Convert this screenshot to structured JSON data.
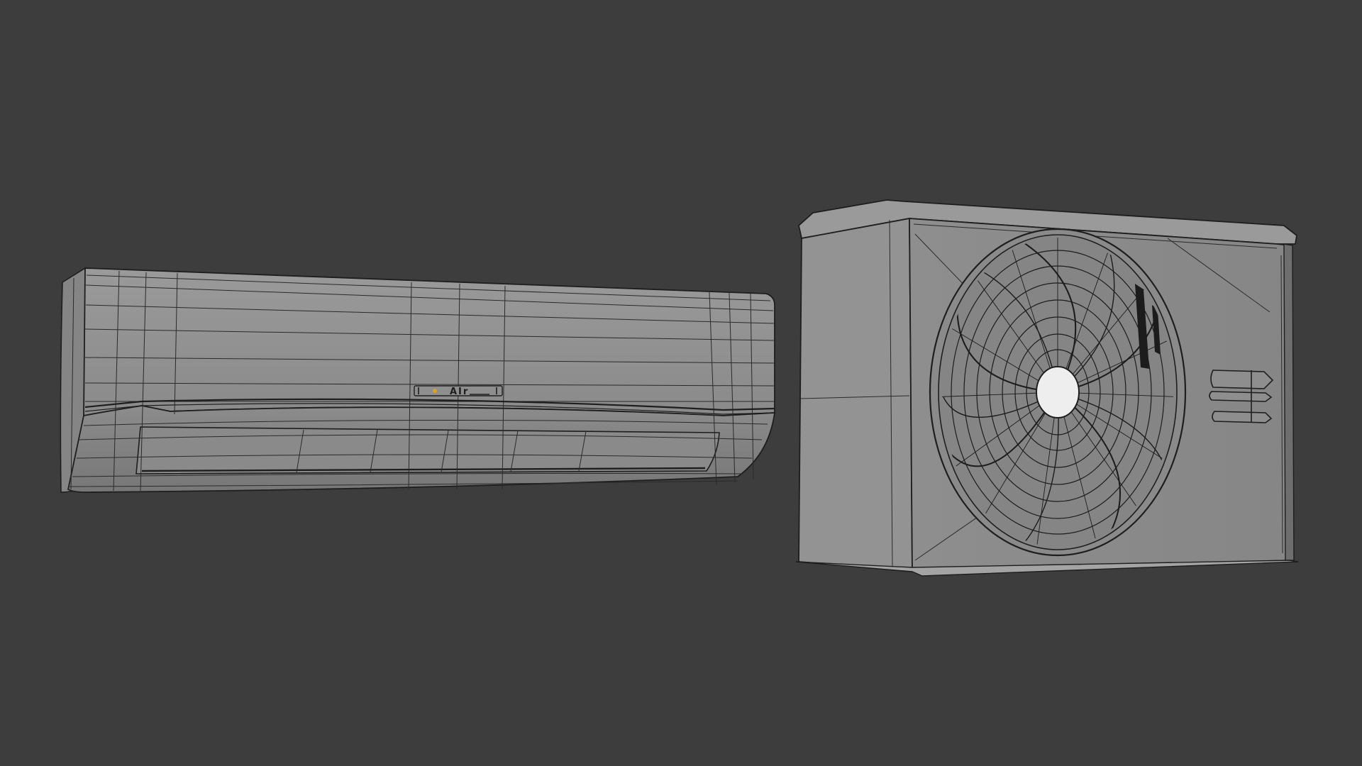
{
  "viewport": {
    "background": "#3d3d3d",
    "shading": "solid-wireframe"
  },
  "indoor_unit": {
    "label": "AIr",
    "indicator_color": "#e0a020",
    "body_color": "#8f8f8f",
    "wire_color": "#1e1e1e"
  },
  "outdoor_unit": {
    "body_color": "#8d8d8d",
    "wire_color": "#1e1e1e",
    "fan_hub_color": "#eeeeee"
  }
}
